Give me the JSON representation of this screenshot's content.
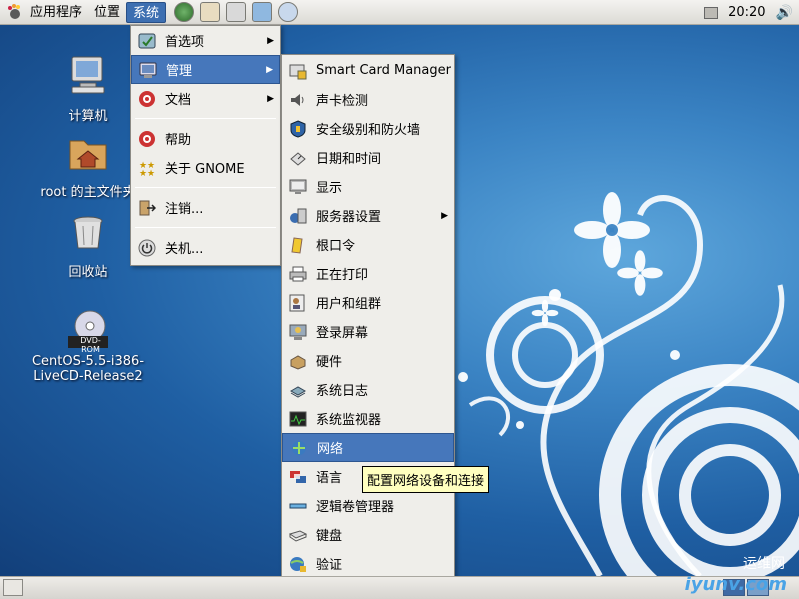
{
  "top_panel": {
    "menus": [
      {
        "label": "应用程序",
        "active": false
      },
      {
        "label": "位置",
        "active": false
      },
      {
        "label": "系统",
        "active": true
      }
    ],
    "clock": "20:20"
  },
  "desktop_icons": [
    {
      "label": "计算机",
      "icon": "computer-icon"
    },
    {
      "label": "root 的主文件夹",
      "icon": "home-folder-icon"
    },
    {
      "label": "回收站",
      "icon": "trash-icon"
    },
    {
      "label_line1": "CentOS-5.5-i386-",
      "label_line2": "LiveCD-Release2",
      "badge": "DVD-ROM",
      "icon": "dvd-icon"
    }
  ],
  "system_menu": {
    "items": [
      {
        "label": "首选项",
        "icon": "preferences-icon",
        "submenu": true
      },
      {
        "label": "管理",
        "icon": "administration-icon",
        "submenu": true,
        "selected": true
      },
      {
        "label": "文档",
        "icon": "help-docs-icon",
        "submenu": true
      },
      {
        "label": "帮助",
        "icon": "help-icon",
        "submenu": false
      },
      {
        "label": "关于 GNOME",
        "icon": "gnome-icon",
        "submenu": false
      },
      {
        "label": "注销...",
        "icon": "logout-icon",
        "submenu": false
      },
      {
        "label": "关机...",
        "icon": "shutdown-icon",
        "submenu": false
      }
    ]
  },
  "admin_menu": {
    "items": [
      {
        "label": "Smart Card Manager",
        "icon": "smartcard-icon"
      },
      {
        "label": "声卡检测",
        "icon": "sound-icon"
      },
      {
        "label": "安全级别和防火墙",
        "icon": "firewall-icon"
      },
      {
        "label": "日期和时间",
        "icon": "date-time-icon"
      },
      {
        "label": "显示",
        "icon": "display-icon"
      },
      {
        "label": "服务器设置",
        "icon": "server-settings-icon",
        "submenu": true
      },
      {
        "label": "根口令",
        "icon": "root-password-icon"
      },
      {
        "label": "正在打印",
        "icon": "printer-icon"
      },
      {
        "label": "用户和组群",
        "icon": "users-groups-icon"
      },
      {
        "label": "登录屏幕",
        "icon": "login-screen-icon"
      },
      {
        "label": "硬件",
        "icon": "hardware-icon"
      },
      {
        "label": "系统日志",
        "icon": "system-log-icon"
      },
      {
        "label": "系统监视器",
        "icon": "system-monitor-icon"
      },
      {
        "label": "网络",
        "icon": "network-icon",
        "selected": true
      },
      {
        "label": "语言",
        "icon": "language-icon"
      },
      {
        "label": "逻辑卷管理器",
        "icon": "lvm-icon"
      },
      {
        "label": "键盘",
        "icon": "keyboard-icon"
      },
      {
        "label": "验证",
        "icon": "authentication-icon"
      }
    ]
  },
  "tooltip": "配置网络设备和连接",
  "watermark": {
    "cn": "运维网",
    "url": "iyunv.com"
  },
  "colors": {
    "selection": "#4677bb",
    "menu_bg": "#efeeea",
    "desktop": "#1f5fa3",
    "tooltip_bg": "#ffffbf"
  }
}
